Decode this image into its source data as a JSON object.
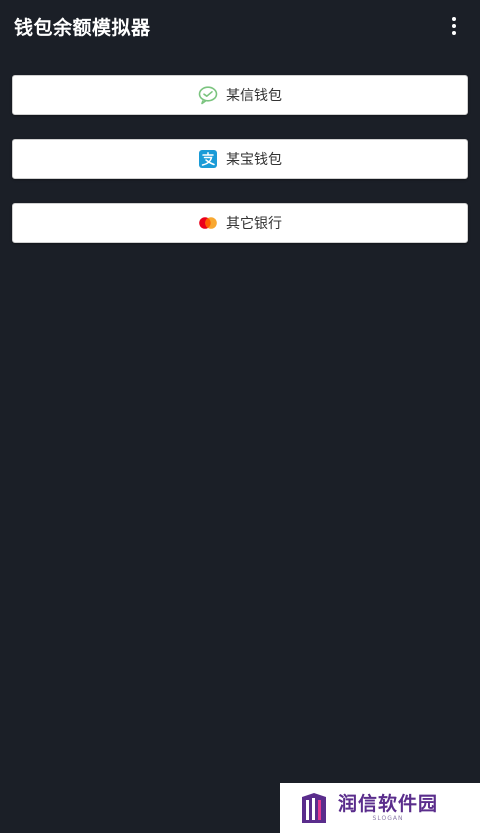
{
  "appbar": {
    "title": "钱包余额模拟器",
    "menu_icon": "more-vertical-icon"
  },
  "wallets": [
    {
      "label": "某信钱包",
      "icon": "wechat-icon",
      "color": "#7bc47f"
    },
    {
      "label": "某宝钱包",
      "icon": "alipay-icon",
      "color": "#1a9bd7"
    },
    {
      "label": "其它银行",
      "icon": "mastercard-icon",
      "color": "#eb001b"
    }
  ],
  "watermark": {
    "name": "润信软件园",
    "slogan": "SLOGAN",
    "color": "#5a2d8c"
  }
}
